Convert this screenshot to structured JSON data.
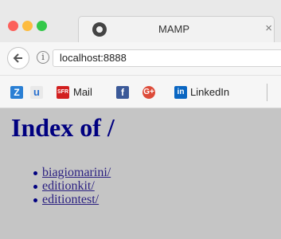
{
  "window": {
    "tab_title": "MAMP",
    "tab_close": "×"
  },
  "toolbar": {
    "back_icon": "back-arrow",
    "info_glyph": "i",
    "url": "localhost:8888"
  },
  "bookmarks": [
    {
      "icon": "Z",
      "label": ""
    },
    {
      "icon": "u",
      "label": ""
    },
    {
      "icon": "SFR",
      "label": "Mail"
    },
    {
      "icon": "f",
      "label": ""
    },
    {
      "icon": "G+",
      "label": ""
    },
    {
      "icon": "in",
      "label": "LinkedIn"
    }
  ],
  "page": {
    "heading": "Index of /",
    "links": [
      "biagiomarini/",
      "editionkit/",
      "editiontest/"
    ]
  },
  "colors": {
    "heading": "#000080",
    "content_bg": "#c5c5c5",
    "traffic_red": "#fc605b",
    "traffic_yellow": "#fdbc40",
    "traffic_green": "#34c84a"
  }
}
